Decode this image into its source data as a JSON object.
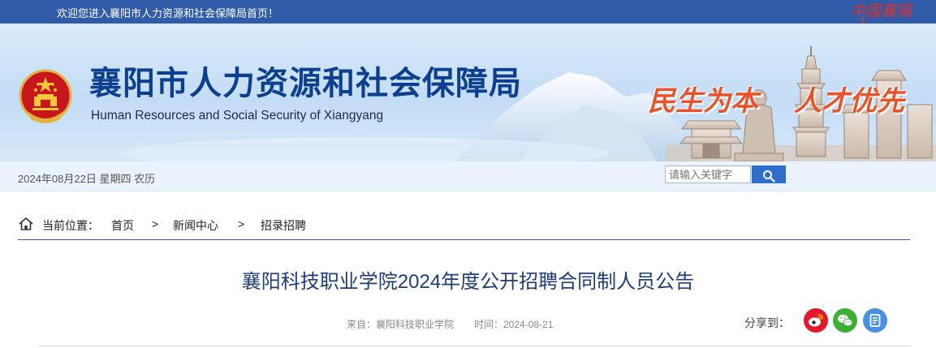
{
  "top_bar": {
    "welcome_text": "欢迎您进入襄阳市人力资源和社会保障局首页！",
    "logo_text": "中國襄陽",
    "background_color": "#2f5ba8"
  },
  "header": {
    "title_cn": "襄阳市人力资源和社会保障局",
    "title_en": "Human Resources and Social Security of Xiangyang",
    "slogan_1": "民生为本",
    "slogan_2": "人才优先",
    "title_color": "#0d3f8f",
    "slogan_color": "#e8532c"
  },
  "info_bar": {
    "date_text": "2024年08月22日 星期四 农历",
    "search_placeholder": "请输入关键字",
    "search_icon": "search-icon"
  },
  "breadcrumb": {
    "icon": "home-icon",
    "label": "当前位置：",
    "items": [
      "首页",
      "新闻中心",
      "招录招聘"
    ],
    "separator": ">"
  },
  "article": {
    "title": "襄阳科技职业学院2024年度公开招聘合同制人员公告",
    "source": "来自：襄阳科技职业学院",
    "time": "时间：2024-08-21",
    "title_color": "#1f3e78"
  },
  "share": {
    "label": "分享到：",
    "buttons": [
      {
        "icon": "weibo-icon",
        "color": "#e6162d"
      },
      {
        "icon": "wechat-icon",
        "color": "#3ab035"
      },
      {
        "icon": "document-icon",
        "color": "#4a90e2"
      }
    ]
  }
}
